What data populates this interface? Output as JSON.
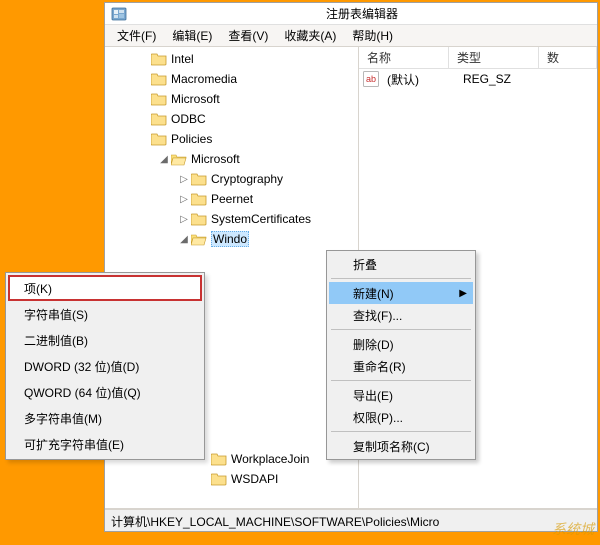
{
  "window": {
    "title": "注册表编辑器"
  },
  "menubar": {
    "file": "文件(F)",
    "edit": "编辑(E)",
    "view": "查看(V)",
    "favorites": "收藏夹(A)",
    "help": "帮助(H)"
  },
  "tree": {
    "items": [
      {
        "label": "Intel",
        "indent": 32,
        "tw": ""
      },
      {
        "label": "Macromedia",
        "indent": 32,
        "tw": ""
      },
      {
        "label": "Microsoft",
        "indent": 32,
        "tw": ""
      },
      {
        "label": "ODBC",
        "indent": 32,
        "tw": ""
      },
      {
        "label": "Policies",
        "indent": 32,
        "tw": ""
      },
      {
        "label": "Microsoft",
        "indent": 52,
        "tw": "◢",
        "open": true
      },
      {
        "label": "Cryptography",
        "indent": 72,
        "tw": "▷"
      },
      {
        "label": "Peernet",
        "indent": 72,
        "tw": "▷"
      },
      {
        "label": "SystemCertificates",
        "indent": 72,
        "tw": "▷"
      },
      {
        "label": "Windo",
        "indent": 72,
        "tw": "◢",
        "open": true,
        "selected": true
      },
      {
        "label": "",
        "indent": 92,
        "tw": "",
        "gap": true
      },
      {
        "label": "",
        "indent": 92,
        "tw": "",
        "gap": true
      },
      {
        "label": "",
        "indent": 92,
        "tw": "",
        "gap": true
      },
      {
        "label": "",
        "indent": 92,
        "tw": "",
        "gap": true
      },
      {
        "label": "",
        "indent": 92,
        "tw": "",
        "gap": true
      },
      {
        "label": "",
        "indent": 92,
        "tw": "",
        "gap": true
      },
      {
        "label": "",
        "indent": 92,
        "tw": "",
        "gap": true
      },
      {
        "label": "",
        "indent": 92,
        "tw": "",
        "gap": true
      },
      {
        "label": "",
        "indent": 92,
        "tw": "",
        "gap": true
      },
      {
        "label": "",
        "indent": 92,
        "tw": "",
        "gap": true
      },
      {
        "label": "WorkplaceJoin",
        "indent": 92,
        "tw": ""
      },
      {
        "label": "WSDAPI",
        "indent": 92,
        "tw": ""
      }
    ]
  },
  "list": {
    "columns": {
      "name": "名称",
      "type": "类型",
      "data": "数"
    },
    "row": {
      "name": "(默认)",
      "type": "REG_SZ"
    }
  },
  "ctxmenu1": {
    "collapse": "折叠",
    "new": "新建(N)",
    "find": "查找(F)...",
    "delete": "删除(D)",
    "rename": "重命名(R)",
    "export": "导出(E)",
    "permissions": "权限(P)...",
    "copykeyname": "复制项名称(C)"
  },
  "submenu": {
    "items": [
      {
        "label": "项(K)",
        "highlight": true
      },
      {
        "label": "字符串值(S)"
      },
      {
        "label": "二进制值(B)"
      },
      {
        "label": "DWORD (32 位)值(D)"
      },
      {
        "label": "QWORD (64 位)值(Q)"
      },
      {
        "label": "多字符串值(M)"
      },
      {
        "label": "可扩充字符串值(E)"
      }
    ]
  },
  "status": {
    "path": "计算机\\HKEY_LOCAL_MACHINE\\SOFTWARE\\Policies\\Micro"
  },
  "watermark": "系统城"
}
